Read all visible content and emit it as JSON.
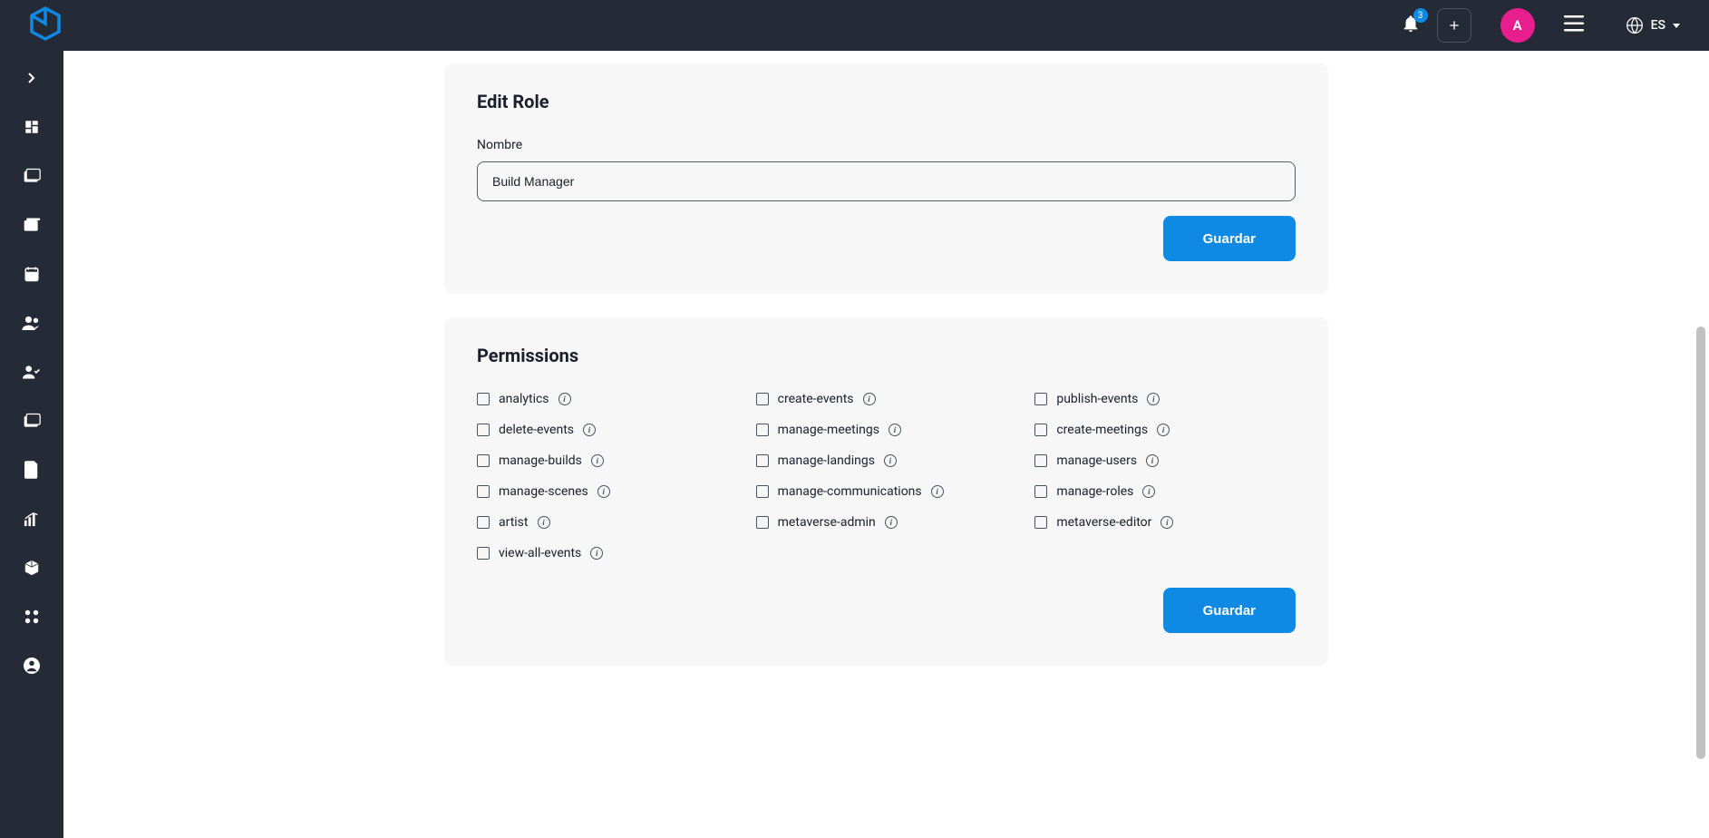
{
  "header": {
    "notification_count": "3",
    "avatar_letter": "A",
    "language": "ES"
  },
  "edit_role": {
    "title": "Edit Role",
    "name_label": "Nombre",
    "name_value": "Build Manager",
    "save_button": "Guardar"
  },
  "permissions": {
    "title": "Permissions",
    "save_button": "Guardar",
    "items": [
      {
        "label": "analytics"
      },
      {
        "label": "create-events"
      },
      {
        "label": "publish-events"
      },
      {
        "label": "delete-events"
      },
      {
        "label": "manage-meetings"
      },
      {
        "label": "create-meetings"
      },
      {
        "label": "manage-builds"
      },
      {
        "label": "manage-landings"
      },
      {
        "label": "manage-users"
      },
      {
        "label": "manage-scenes"
      },
      {
        "label": "manage-communications"
      },
      {
        "label": "manage-roles"
      },
      {
        "label": "artist"
      },
      {
        "label": "metaverse-admin"
      },
      {
        "label": "metaverse-editor"
      },
      {
        "label": "view-all-events"
      }
    ]
  }
}
